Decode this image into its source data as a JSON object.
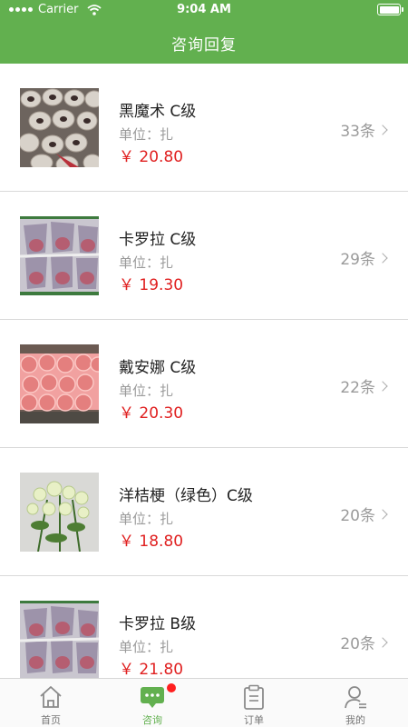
{
  "status_bar": {
    "carrier": "Carrier",
    "time": "9:04 AM"
  },
  "header": {
    "title": "咨询回复"
  },
  "items": [
    {
      "name": "黑魔术 C级",
      "unit": "单位：扎",
      "price": "￥ 20.80",
      "count": "33条"
    },
    {
      "name": "卡罗拉 C级",
      "unit": "单位：扎",
      "price": "￥ 19.30",
      "count": "29条"
    },
    {
      "name": "戴安娜 C级",
      "unit": "单位：扎",
      "price": "￥ 20.30",
      "count": "22条"
    },
    {
      "name": "洋桔梗（绿色）C级",
      "unit": "单位：扎",
      "price": "￥ 18.80",
      "count": "20条"
    },
    {
      "name": "卡罗拉 B级",
      "unit": "单位：扎",
      "price": "￥ 21.80",
      "count": "20条"
    }
  ],
  "tabbar": {
    "tabs": [
      {
        "label": "首页",
        "icon": "home-icon"
      },
      {
        "label": "咨询",
        "icon": "chat-icon"
      },
      {
        "label": "订单",
        "icon": "clipboard-icon"
      },
      {
        "label": "我的",
        "icon": "user-icon"
      }
    ]
  },
  "colors": {
    "brand": "#62b04f",
    "price": "#e02020",
    "badge": "#ff1f1f"
  }
}
